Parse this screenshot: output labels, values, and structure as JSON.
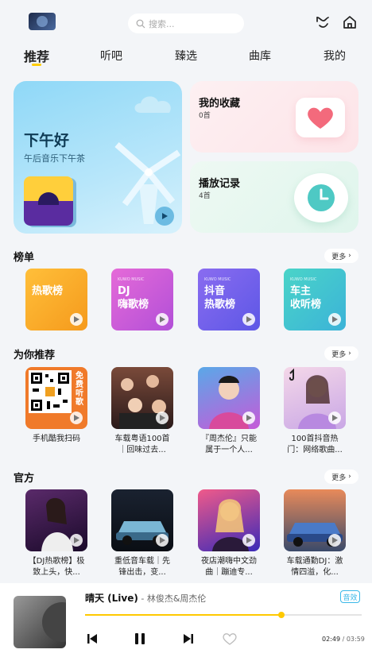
{
  "header": {
    "search_placeholder": "搜索...",
    "tabs": [
      "推荐",
      "听吧",
      "臻选",
      "曲库",
      "我的"
    ]
  },
  "hero": {
    "greeting": "下午好",
    "subtitle": "午后音乐下午茶"
  },
  "quick_cards": {
    "favorites": {
      "title": "我的收藏",
      "count": "0首"
    },
    "history": {
      "title": "播放记录",
      "count": "4首"
    }
  },
  "charts_section": {
    "title": "榜单",
    "more": "更多",
    "items": [
      {
        "brand": "",
        "name": "热歌榜"
      },
      {
        "brand": "KUWO MUSIC",
        "name": "DJ\n嗨歌榜"
      },
      {
        "brand": "KUWO MUSIC",
        "name": "抖音\n热歌榜"
      },
      {
        "brand": "KUWO MUSIC",
        "name": "车主\n收听榜"
      }
    ]
  },
  "recommend_section": {
    "title": "为你推荐",
    "more": "更多",
    "items": [
      {
        "caption": "手机酷我扫码",
        "badge": "免费听歌"
      },
      {
        "caption": "车载粤语100首｜回味过去..."
      },
      {
        "caption": "『周杰伦』只能属于一个人..."
      },
      {
        "caption": "100首抖音热门：网络歌曲..."
      }
    ]
  },
  "official_section": {
    "title": "官方",
    "more": "更多",
    "items": [
      {
        "caption": "【DJ热歌榜】极致上头，快..."
      },
      {
        "caption": "重低音车载｜先锋出击，变..."
      },
      {
        "caption": "夜店潮嗨中文劲曲｜蹦迪专..."
      },
      {
        "caption": "车载通勤DJ：激情四溢，化..."
      }
    ]
  },
  "player": {
    "title": "晴天 (Live)",
    "artist": " - 林俊杰&周杰伦",
    "sound_effect": "音效",
    "current_time": "02:49",
    "separator": " / ",
    "total_time": "03:59",
    "progress": 0.71
  },
  "colors": {
    "accent": "#ffcc00",
    "effect": "#3ab8e8"
  }
}
